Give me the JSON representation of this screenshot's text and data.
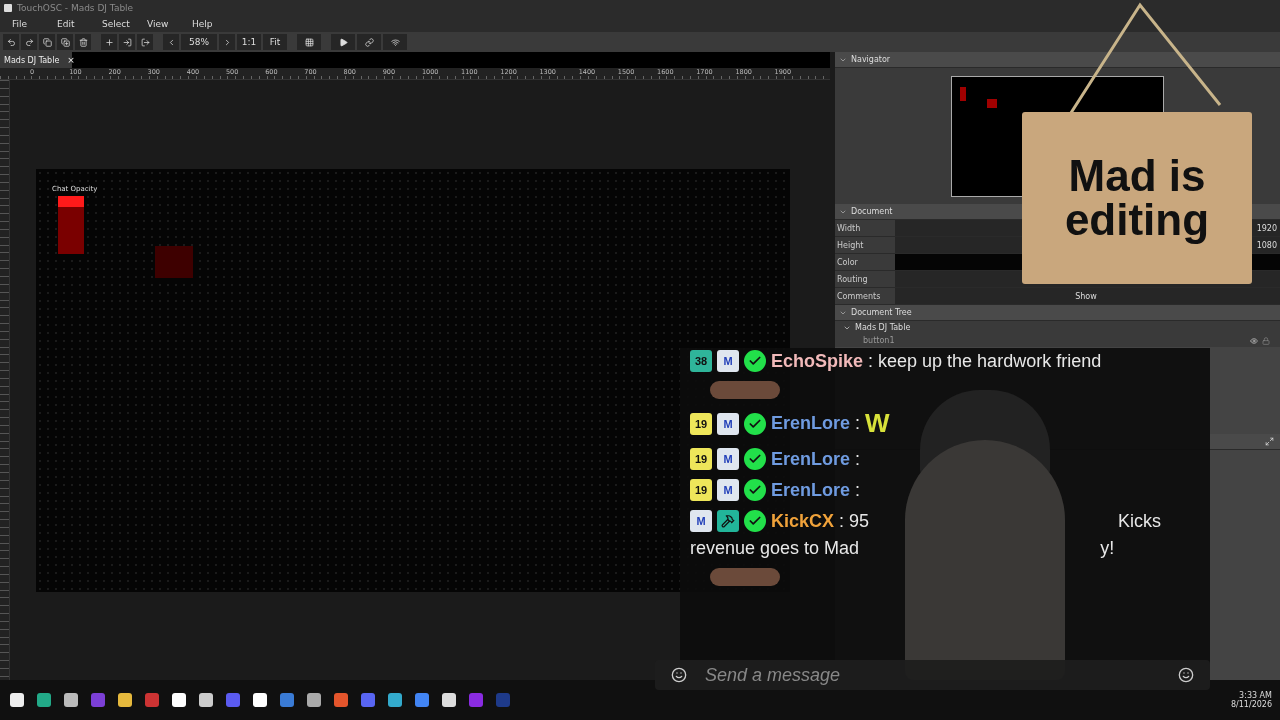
{
  "window": {
    "title": "TouchOSC - Mads DJ Table"
  },
  "menu": [
    "File",
    "Edit",
    "Select",
    "View",
    "Help"
  ],
  "toolbar": {
    "zoom": "58%",
    "buttons": [
      "1:1",
      "Fit"
    ]
  },
  "tab": {
    "label": "Mads DJ Table",
    "close": "×"
  },
  "ruler": [
    "0",
    "100",
    "200",
    "300",
    "400",
    "500",
    "600",
    "700",
    "800",
    "900",
    "1000",
    "1100",
    "1200",
    "1300",
    "1400",
    "1500",
    "1600",
    "1700",
    "1800",
    "1900"
  ],
  "canvas": {
    "fader_label": "Chat Opacity"
  },
  "navigator": {
    "title": "Navigator"
  },
  "document": {
    "title": "Document",
    "rows": [
      {
        "label": "Width",
        "kind": "text",
        "value": "1920"
      },
      {
        "label": "Height",
        "kind": "text",
        "value": "1080"
      },
      {
        "label": "Color",
        "kind": "swatch"
      },
      {
        "label": "Routing",
        "kind": "empty"
      },
      {
        "label": "Comments",
        "kind": "center",
        "value": "Show"
      }
    ]
  },
  "tree": {
    "title": "Document Tree",
    "root": "Mads DJ Table",
    "expanded": true,
    "children": [
      "button1"
    ]
  },
  "sign": {
    "text": "Mad is editing"
  },
  "chat": {
    "items": [
      {
        "kind": "message",
        "badges": [
          {
            "kind": "level",
            "label": "38",
            "color": "#2fb59a"
          },
          {
            "kind": "letter",
            "label": "M"
          },
          {
            "kind": "verified"
          }
        ],
        "user": "EchoSpike",
        "color": "#f1b9b9",
        "text": ": keep up the hardwork friend"
      },
      {
        "kind": "emote"
      },
      {
        "kind": "message",
        "badges": [
          {
            "kind": "level",
            "label": "19",
            "color": "#eee65a"
          },
          {
            "kind": "letter",
            "label": "M"
          },
          {
            "kind": "verified"
          }
        ],
        "user": "ErenLore",
        "color": "#6f9be0",
        "text": ":",
        "after": "W"
      },
      {
        "kind": "message",
        "badges": [
          {
            "kind": "level",
            "label": "19",
            "color": "#eee65a"
          },
          {
            "kind": "letter",
            "label": "M"
          },
          {
            "kind": "verified"
          }
        ],
        "user": "ErenLore",
        "color": "#6f9be0",
        "text": ":"
      },
      {
        "kind": "message",
        "badges": [
          {
            "kind": "level",
            "label": "19",
            "color": "#eee65a"
          },
          {
            "kind": "letter",
            "label": "M"
          },
          {
            "kind": "verified"
          }
        ],
        "user": "ErenLore",
        "color": "#6f9be0",
        "text": ":"
      },
      {
        "kind": "message",
        "badges": [
          {
            "kind": "letter",
            "label": "M"
          },
          {
            "kind": "hammer"
          },
          {
            "kind": "verified"
          }
        ],
        "user": "KickCX",
        "color": "#f0a23a",
        "text": ": 95",
        "tail": "Kicks",
        "line2": "revenue goes to Mad",
        "line2tail": "y!"
      },
      {
        "kind": "emote"
      }
    ],
    "input_placeholder": "Send a message"
  },
  "taskbar": {
    "time": "3:33 AM",
    "date": "8/11/2026"
  }
}
